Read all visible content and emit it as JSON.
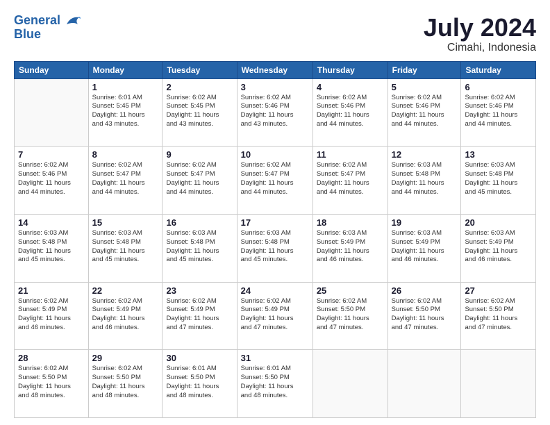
{
  "header": {
    "logo_line1": "General",
    "logo_line2": "Blue",
    "month": "July 2024",
    "location": "Cimahi, Indonesia"
  },
  "weekdays": [
    "Sunday",
    "Monday",
    "Tuesday",
    "Wednesday",
    "Thursday",
    "Friday",
    "Saturday"
  ],
  "weeks": [
    [
      {
        "day": "",
        "info": ""
      },
      {
        "day": "1",
        "info": "Sunrise: 6:01 AM\nSunset: 5:45 PM\nDaylight: 11 hours\nand 43 minutes."
      },
      {
        "day": "2",
        "info": "Sunrise: 6:02 AM\nSunset: 5:45 PM\nDaylight: 11 hours\nand 43 minutes."
      },
      {
        "day": "3",
        "info": "Sunrise: 6:02 AM\nSunset: 5:46 PM\nDaylight: 11 hours\nand 43 minutes."
      },
      {
        "day": "4",
        "info": "Sunrise: 6:02 AM\nSunset: 5:46 PM\nDaylight: 11 hours\nand 44 minutes."
      },
      {
        "day": "5",
        "info": "Sunrise: 6:02 AM\nSunset: 5:46 PM\nDaylight: 11 hours\nand 44 minutes."
      },
      {
        "day": "6",
        "info": "Sunrise: 6:02 AM\nSunset: 5:46 PM\nDaylight: 11 hours\nand 44 minutes."
      }
    ],
    [
      {
        "day": "7",
        "info": "Sunrise: 6:02 AM\nSunset: 5:46 PM\nDaylight: 11 hours\nand 44 minutes."
      },
      {
        "day": "8",
        "info": "Sunrise: 6:02 AM\nSunset: 5:47 PM\nDaylight: 11 hours\nand 44 minutes."
      },
      {
        "day": "9",
        "info": "Sunrise: 6:02 AM\nSunset: 5:47 PM\nDaylight: 11 hours\nand 44 minutes."
      },
      {
        "day": "10",
        "info": "Sunrise: 6:02 AM\nSunset: 5:47 PM\nDaylight: 11 hours\nand 44 minutes."
      },
      {
        "day": "11",
        "info": "Sunrise: 6:02 AM\nSunset: 5:47 PM\nDaylight: 11 hours\nand 44 minutes."
      },
      {
        "day": "12",
        "info": "Sunrise: 6:03 AM\nSunset: 5:48 PM\nDaylight: 11 hours\nand 44 minutes."
      },
      {
        "day": "13",
        "info": "Sunrise: 6:03 AM\nSunset: 5:48 PM\nDaylight: 11 hours\nand 45 minutes."
      }
    ],
    [
      {
        "day": "14",
        "info": "Sunrise: 6:03 AM\nSunset: 5:48 PM\nDaylight: 11 hours\nand 45 minutes."
      },
      {
        "day": "15",
        "info": "Sunrise: 6:03 AM\nSunset: 5:48 PM\nDaylight: 11 hours\nand 45 minutes."
      },
      {
        "day": "16",
        "info": "Sunrise: 6:03 AM\nSunset: 5:48 PM\nDaylight: 11 hours\nand 45 minutes."
      },
      {
        "day": "17",
        "info": "Sunrise: 6:03 AM\nSunset: 5:48 PM\nDaylight: 11 hours\nand 45 minutes."
      },
      {
        "day": "18",
        "info": "Sunrise: 6:03 AM\nSunset: 5:49 PM\nDaylight: 11 hours\nand 46 minutes."
      },
      {
        "day": "19",
        "info": "Sunrise: 6:03 AM\nSunset: 5:49 PM\nDaylight: 11 hours\nand 46 minutes."
      },
      {
        "day": "20",
        "info": "Sunrise: 6:03 AM\nSunset: 5:49 PM\nDaylight: 11 hours\nand 46 minutes."
      }
    ],
    [
      {
        "day": "21",
        "info": "Sunrise: 6:02 AM\nSunset: 5:49 PM\nDaylight: 11 hours\nand 46 minutes."
      },
      {
        "day": "22",
        "info": "Sunrise: 6:02 AM\nSunset: 5:49 PM\nDaylight: 11 hours\nand 46 minutes."
      },
      {
        "day": "23",
        "info": "Sunrise: 6:02 AM\nSunset: 5:49 PM\nDaylight: 11 hours\nand 47 minutes."
      },
      {
        "day": "24",
        "info": "Sunrise: 6:02 AM\nSunset: 5:49 PM\nDaylight: 11 hours\nand 47 minutes."
      },
      {
        "day": "25",
        "info": "Sunrise: 6:02 AM\nSunset: 5:50 PM\nDaylight: 11 hours\nand 47 minutes."
      },
      {
        "day": "26",
        "info": "Sunrise: 6:02 AM\nSunset: 5:50 PM\nDaylight: 11 hours\nand 47 minutes."
      },
      {
        "day": "27",
        "info": "Sunrise: 6:02 AM\nSunset: 5:50 PM\nDaylight: 11 hours\nand 47 minutes."
      }
    ],
    [
      {
        "day": "28",
        "info": "Sunrise: 6:02 AM\nSunset: 5:50 PM\nDaylight: 11 hours\nand 48 minutes."
      },
      {
        "day": "29",
        "info": "Sunrise: 6:02 AM\nSunset: 5:50 PM\nDaylight: 11 hours\nand 48 minutes."
      },
      {
        "day": "30",
        "info": "Sunrise: 6:01 AM\nSunset: 5:50 PM\nDaylight: 11 hours\nand 48 minutes."
      },
      {
        "day": "31",
        "info": "Sunrise: 6:01 AM\nSunset: 5:50 PM\nDaylight: 11 hours\nand 48 minutes."
      },
      {
        "day": "",
        "info": ""
      },
      {
        "day": "",
        "info": ""
      },
      {
        "day": "",
        "info": ""
      }
    ]
  ]
}
